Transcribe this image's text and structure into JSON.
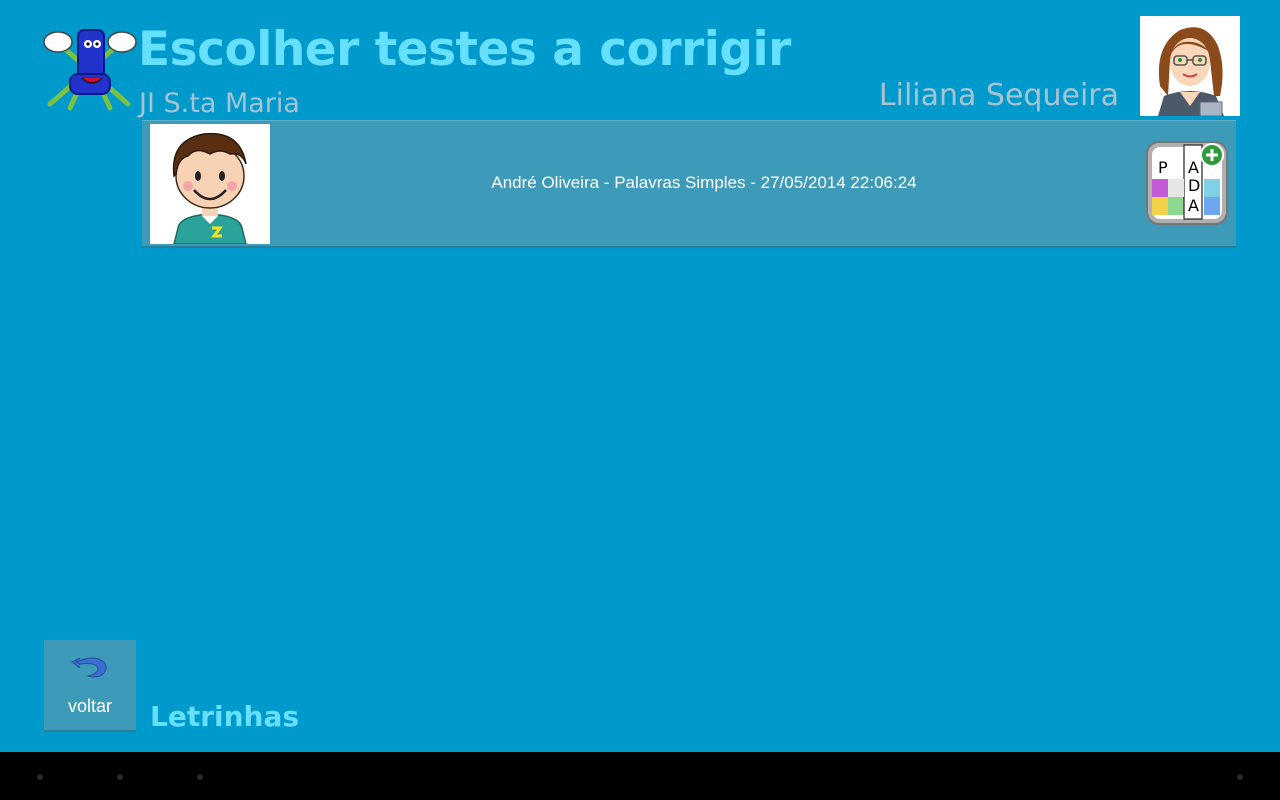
{
  "header": {
    "title": "Escolher testes a corrigir",
    "school": "JI S.ta Maria",
    "teacher_name": "Liliana Sequeira",
    "logo_icon": "letrinhas-mascot-icon",
    "teacher_avatar_icon": "teacher-avatar-icon"
  },
  "tests": [
    {
      "label": "André Oliveira - Palavras Simples - 27/05/2014 22:06:24",
      "student_avatar_icon": "student-boy-avatar-icon",
      "game_icon": "word-puzzle-icon"
    }
  ],
  "footer": {
    "back_label": "voltar",
    "back_icon": "undo-arrow-icon",
    "app_name": "Letrinhas"
  },
  "colors": {
    "background": "#0099cc",
    "title": "#66e0ff",
    "subtext": "#a7c3d2",
    "row_background": "#3d9ab8"
  }
}
